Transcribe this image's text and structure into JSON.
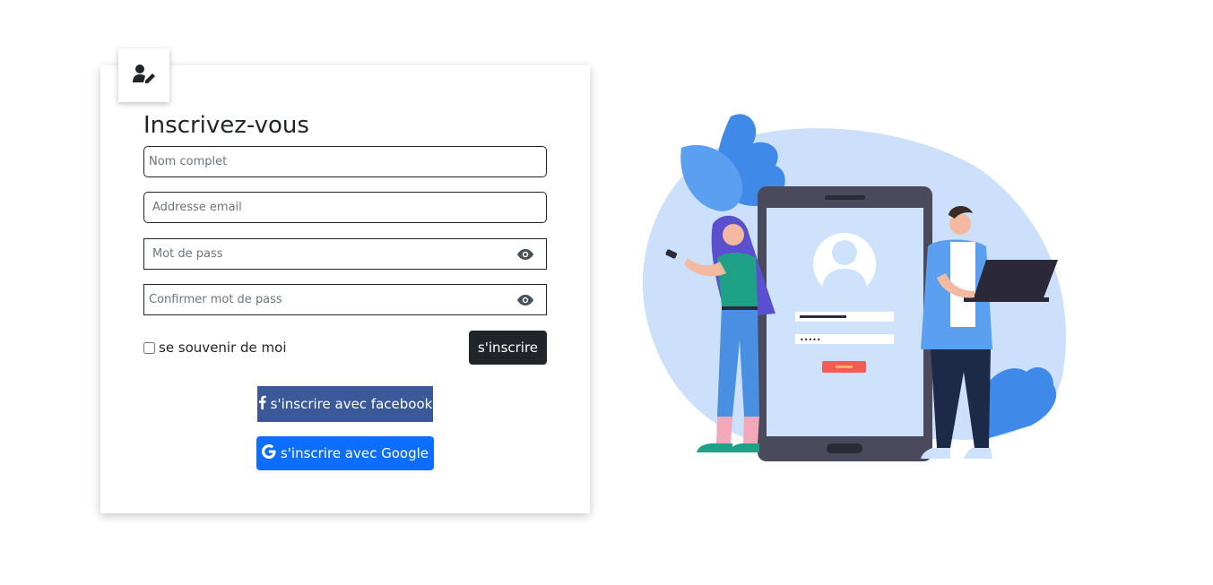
{
  "header": {
    "title": "Inscrivez-vous",
    "icon": "user-edit-icon"
  },
  "form": {
    "full_name": {
      "placeholder": "Nom complet",
      "value": ""
    },
    "email": {
      "placeholder": "Addresse email",
      "value": ""
    },
    "password": {
      "placeholder": "Mot de pass",
      "value": "",
      "icon": "eye-icon"
    },
    "confirm_password": {
      "placeholder": "Confirmer mot de pass",
      "value": "",
      "icon": "eye-icon"
    },
    "remember_label": "se souvenir de moi",
    "remember_checked": false,
    "submit_label": "s'inscrire"
  },
  "social": {
    "facebook_label": "s'inscrire avec facebook",
    "google_label": "s'inscrire avec Google",
    "facebook_color": "#3b5998",
    "google_color": "#0d6efd"
  },
  "illustration": {
    "phone_password_mask": "•••••"
  },
  "colors": {
    "dark": "#212529",
    "accent_light_blue": "#cce0fb",
    "accent_blue": "#3f8ae8"
  }
}
